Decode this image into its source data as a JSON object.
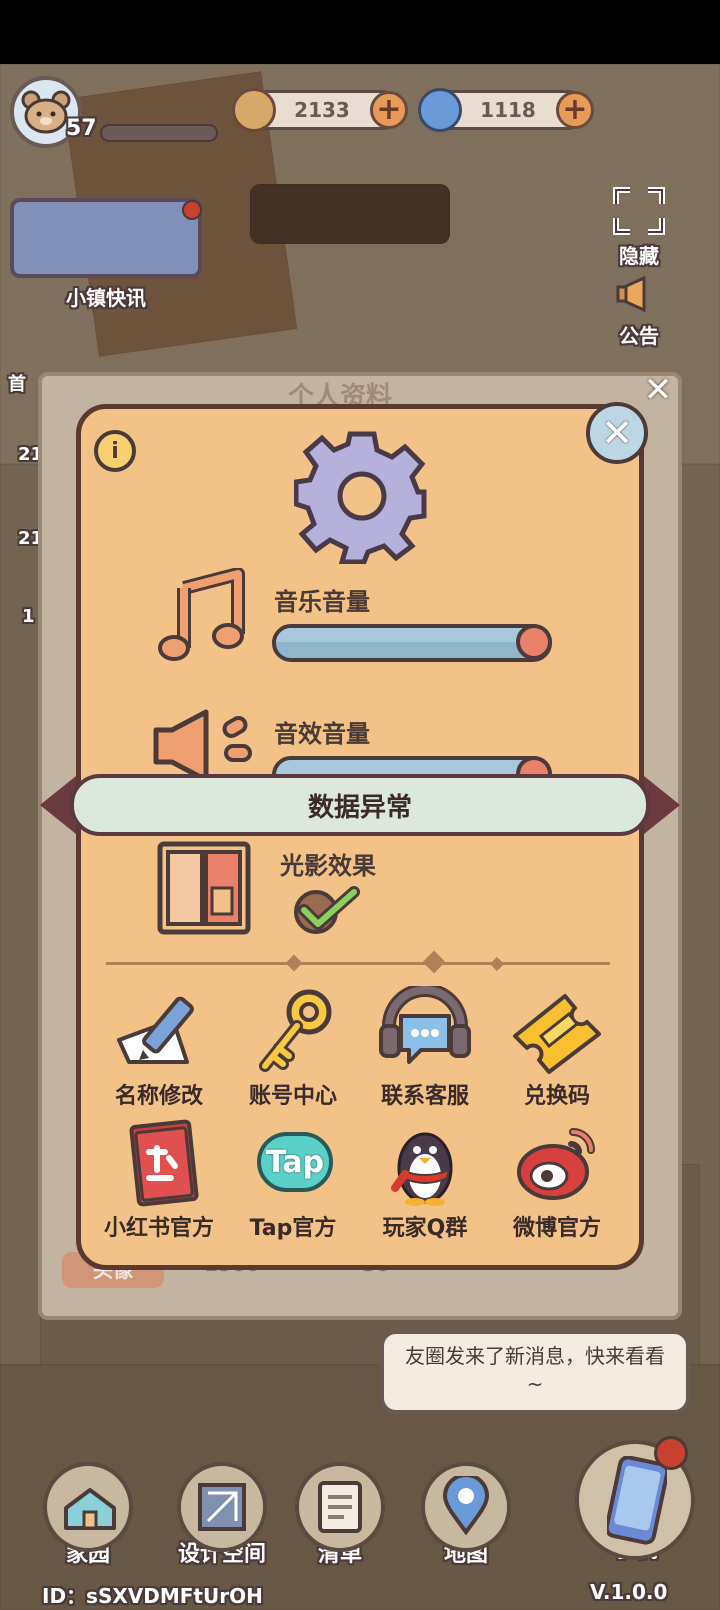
{
  "top_bar": {
    "level": "57",
    "coins": "2133",
    "gems": "1118"
  },
  "side": {
    "news_label": "小镇快讯",
    "hide_label": "隐藏",
    "notice_label": "公告",
    "first_label": "首",
    "num1": "21",
    "num2": "21",
    "num3": "1"
  },
  "panel": {
    "title_partial": "个人资料",
    "music_label": "音乐音量",
    "music_value": 1.0,
    "sfx_label": "音效音量",
    "sfx_value": 1.0,
    "light_label": "光影效果",
    "light_checked": true,
    "banner_text": "数据异常",
    "info_icon": "i",
    "actions": [
      {
        "label": "名称修改",
        "icon": "pencil-icon"
      },
      {
        "label": "账号中心",
        "icon": "key-icon"
      },
      {
        "label": "联系客服",
        "icon": "headset-icon"
      },
      {
        "label": "兑换码",
        "icon": "ticket-icon"
      }
    ],
    "socials": [
      {
        "label": "小红书官方",
        "icon": "red-book-icon"
      },
      {
        "label": "Tap官方",
        "icon": "tap-icon",
        "icon_text": "Tap"
      },
      {
        "label": "玩家Q群",
        "icon": "penguin-icon"
      },
      {
        "label": "微博官方",
        "icon": "weibo-icon"
      }
    ],
    "behind_text_1": "1500",
    "behind_text_2": "30",
    "behind_text_3": "头像"
  },
  "message_bubble": "友圈发来了新消息，快来看看~",
  "bottom_nav": [
    {
      "label": "家园",
      "icon": "house-icon"
    },
    {
      "label": "设计空间",
      "icon": "blueprint-icon"
    },
    {
      "label": "清单",
      "icon": "list-icon"
    },
    {
      "label": "地图",
      "icon": "map-pin-icon"
    },
    {
      "label": "手机",
      "icon": "phone-icon"
    }
  ],
  "footer": {
    "id_text": "ID：sSXVDMFtUrOH",
    "version": "V.1.0.0"
  },
  "colors": {
    "panel_bg": "#f2c288",
    "accent_orange": "#e8806a",
    "slider_blue": "#8fb6cc",
    "banner_green": "#dce8dc",
    "outline": "#5a3a30"
  }
}
